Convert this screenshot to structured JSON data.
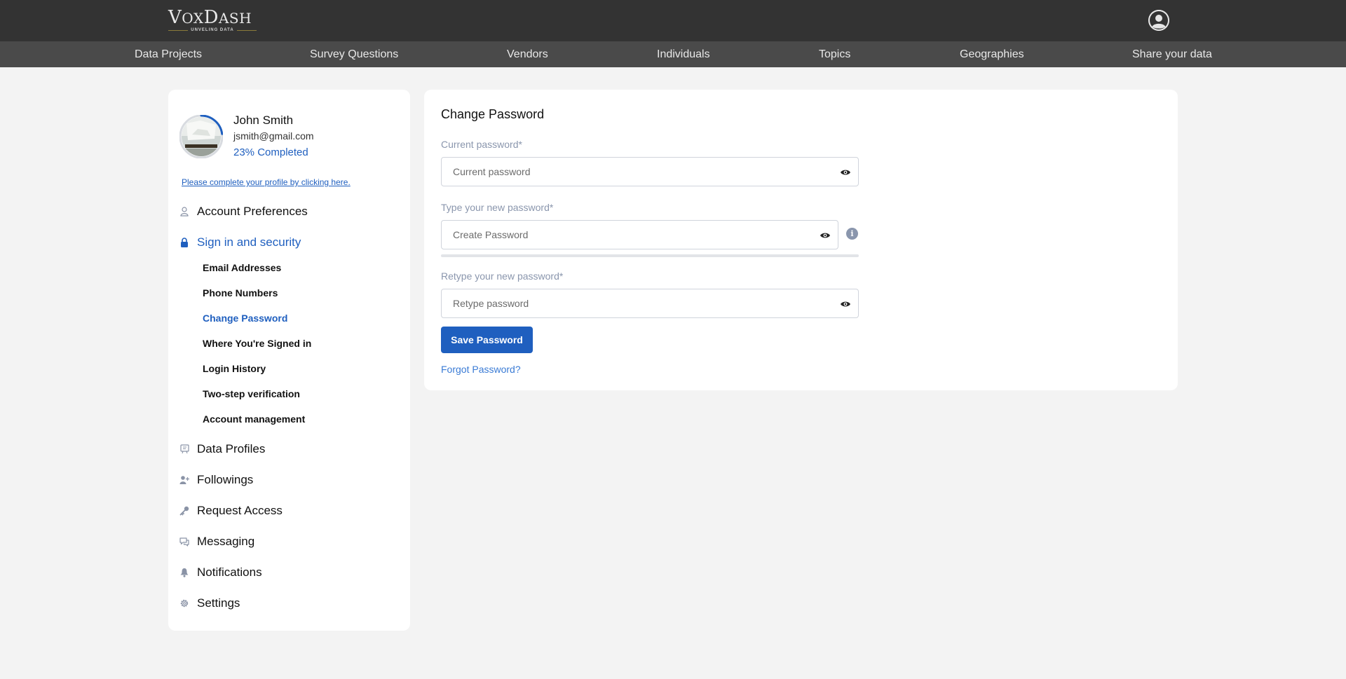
{
  "header": {
    "logo_text": "VoxDash",
    "logo_tagline": "UNVELING DATA",
    "user_icon": "user-circle-icon"
  },
  "nav": {
    "items": [
      "Data Projects",
      "Survey Questions",
      "Vendors",
      "Individuals",
      "Topics",
      "Geographies",
      "Share your data"
    ]
  },
  "profile": {
    "name": "John Smith",
    "email": "jsmith@gmail.com",
    "progress_text": "23% Completed",
    "progress_percent": 23,
    "complete_link": "Please complete your profile by clicking here."
  },
  "sidebar": {
    "items": [
      {
        "label": "Account Preferences",
        "icon": "user-icon"
      },
      {
        "label": "Sign in and security",
        "icon": "lock-icon",
        "active": true
      },
      {
        "label": "Data Profiles",
        "icon": "clipboard-icon"
      },
      {
        "label": "Followings",
        "icon": "user-plus-icon"
      },
      {
        "label": "Request Access",
        "icon": "key-icon"
      },
      {
        "label": "Messaging",
        "icon": "chat-icon"
      },
      {
        "label": "Notifications",
        "icon": "bell-icon"
      },
      {
        "label": "Settings",
        "icon": "gear-icon"
      }
    ],
    "subitems": [
      "Email Addresses",
      "Phone Numbers",
      "Change Password",
      "Where You're Signed in",
      "Login History",
      "Two-step verification",
      "Account management"
    ],
    "active_subitem": "Change Password"
  },
  "form": {
    "title": "Change Password",
    "current_label": "Current password*",
    "current_placeholder": "Current password",
    "new_label": "Type your new password*",
    "new_placeholder": "Create Password",
    "retype_label": "Retype your new password*",
    "retype_placeholder": "Retype password",
    "strength_percent": 0,
    "save_label": "Save Password",
    "forgot_label": "Forgot Password?"
  },
  "colors": {
    "accent": "#1f5fbf",
    "header_bg": "#333333",
    "nav_bg": "#4a4a4a",
    "page_bg": "#f3f3f3"
  }
}
